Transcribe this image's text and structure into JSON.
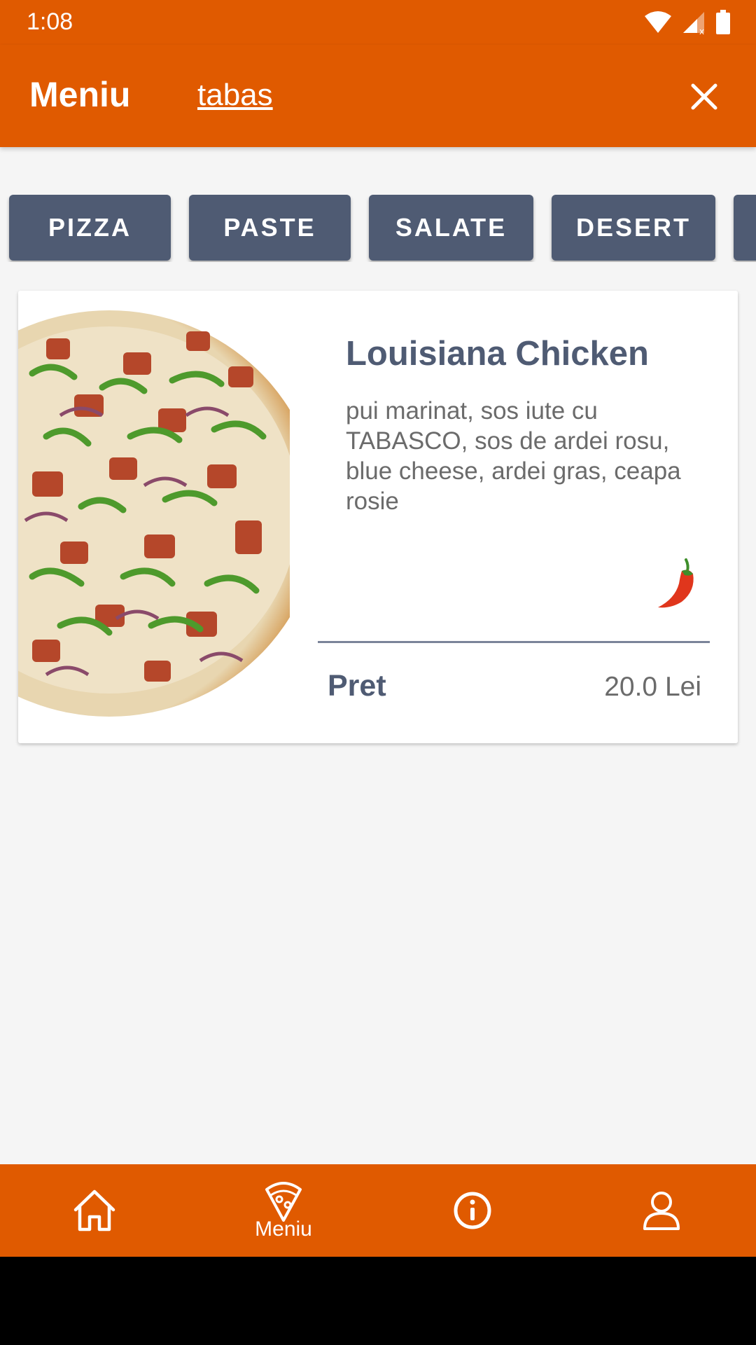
{
  "status_bar": {
    "time": "1:08"
  },
  "toolbar": {
    "title": "Meniu",
    "search_value": "tabas"
  },
  "categories": [
    "PIZZA",
    "PASTE",
    "SALATE",
    "DESERT",
    ""
  ],
  "card": {
    "name": "Louisiana Chicken",
    "description": "pui marinat, sos iute cu TABASCO, sos de ardei rosu, blue cheese, ardei gras, ceapa rosie",
    "price_label": "Pret",
    "price_value": "20.0 Lei",
    "spicy_icon": "chili-pepper-icon"
  },
  "bottom_nav": {
    "items": [
      {
        "icon": "home-icon",
        "label": ""
      },
      {
        "icon": "pizza-slice-icon",
        "label": "Meniu"
      },
      {
        "icon": "info-icon",
        "label": ""
      },
      {
        "icon": "user-icon",
        "label": ""
      }
    ]
  },
  "colors": {
    "primary": "#e05a00",
    "chip": "#4f5b73",
    "background": "#f5f5f5"
  }
}
